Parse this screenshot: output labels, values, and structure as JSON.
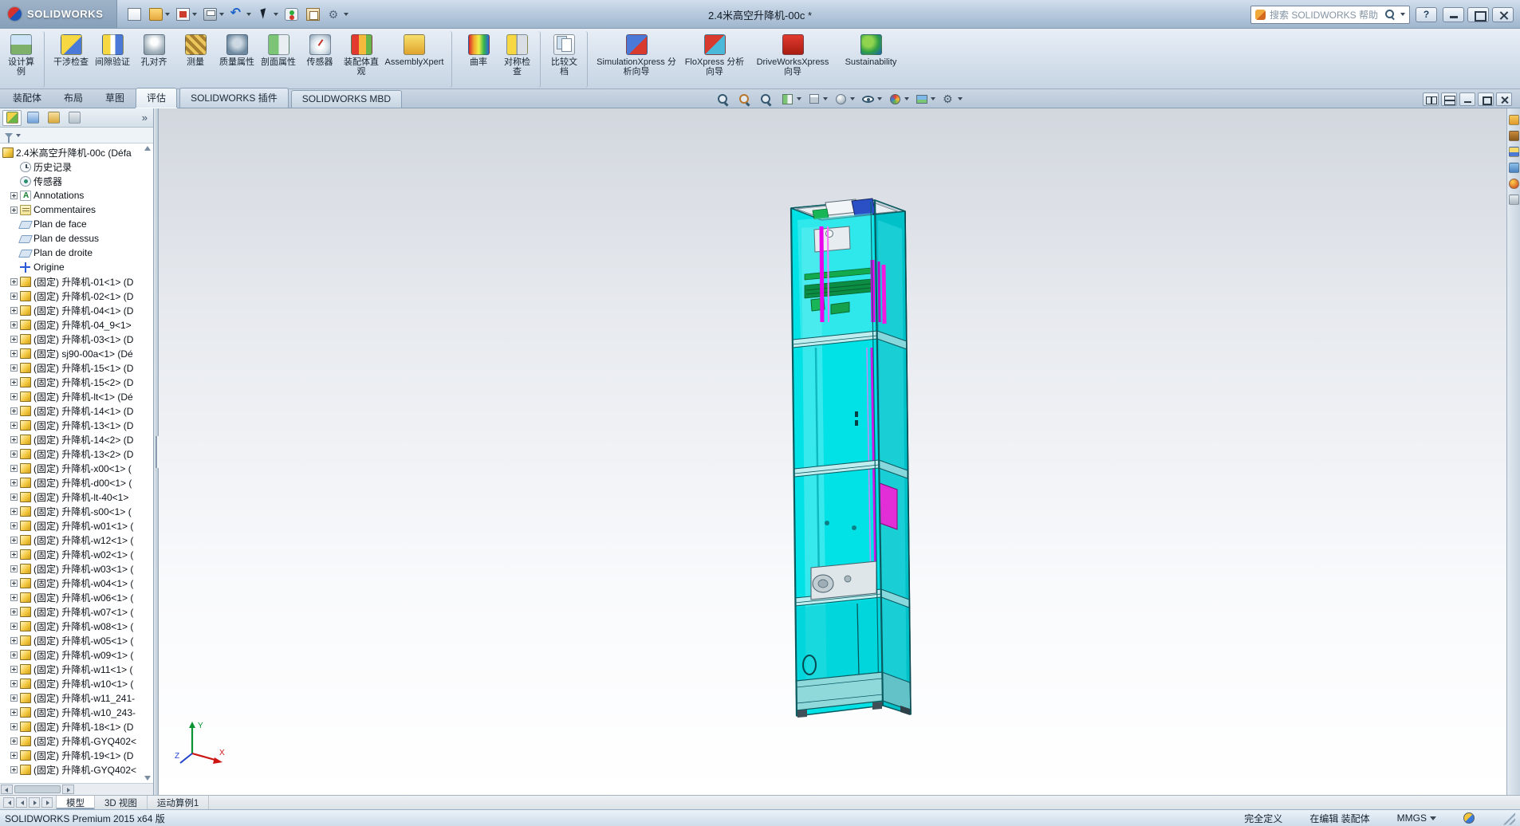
{
  "titlebar": {
    "brand": "SOLIDWORKS",
    "title": "2.4米高空升降机-00c *",
    "search_placeholder": "搜索 SOLIDWORKS 帮助",
    "help_glyph": "?",
    "qat": [
      {
        "icon": "q-new",
        "name": "new-document-icon",
        "dd": "dd-no"
      },
      {
        "icon": "q-open",
        "name": "open-icon",
        "dd": "dd-yes"
      },
      {
        "icon": "q-save",
        "name": "save-icon",
        "dd": "dd-yes"
      },
      {
        "icon": "q-print",
        "name": "print-icon",
        "dd": "dd-yes"
      },
      {
        "icon": "q-undo",
        "name": "undo-icon",
        "dd": "dd-yes"
      },
      {
        "icon": "q-select",
        "name": "select-icon",
        "dd": "dd-yes"
      },
      {
        "icon": "q-rebuild",
        "name": "rebuild-icon",
        "dd": "dd-no"
      },
      {
        "icon": "q-props",
        "name": "file-properties-icon",
        "dd": "dd-no"
      },
      {
        "icon": "q-options",
        "name": "options-icon",
        "dd": "dd-yes"
      }
    ],
    "window_controls": [
      {
        "cls": "wc-min",
        "name": "window-minimize-button"
      },
      {
        "cls": "wc-max",
        "name": "window-maximize-button"
      },
      {
        "cls": "wc-close",
        "name": "window-close-button"
      }
    ]
  },
  "ribbon": {
    "buttons": [
      {
        "label": "设计算例",
        "icon": "i-design-study",
        "name": "design-study-button",
        "cls": "w-s sep-after"
      },
      {
        "label": "干涉检查",
        "icon": "i-interference",
        "name": "interference-check-button",
        "cls": "w-s"
      },
      {
        "label": "间隙验证",
        "icon": "i-clearance",
        "name": "clearance-verification-button",
        "cls": "w-s"
      },
      {
        "label": "孔对齐",
        "icon": "i-hole-align",
        "name": "hole-alignment-button",
        "cls": "w-s"
      },
      {
        "label": "测量",
        "icon": "i-measure",
        "name": "measure-button",
        "cls": "w-s"
      },
      {
        "label": "质量属性",
        "icon": "i-mass",
        "name": "mass-properties-button",
        "cls": "w-s"
      },
      {
        "label": "剖面属性",
        "icon": "i-section-prop",
        "name": "section-properties-button",
        "cls": "w-s"
      },
      {
        "label": "传感器",
        "icon": "i-sensor",
        "name": "sensor-button",
        "cls": "w-s"
      },
      {
        "label": "装配体直观",
        "icon": "i-assembly-vis",
        "name": "assembly-visualization-button",
        "cls": "w-s"
      },
      {
        "label": "AssemblyXpert",
        "icon": "i-assemblyxpert",
        "name": "assemblyxpert-button",
        "cls": "w-m sep-after"
      },
      {
        "label": "曲率",
        "icon": "i-curvature",
        "name": "curvature-button",
        "cls": "w-s"
      },
      {
        "label": "对称检查",
        "icon": "i-symmetry",
        "name": "symmetry-check-button",
        "cls": "w-s sep-after"
      },
      {
        "label": "比较文档",
        "icon": "i-compare",
        "name": "compare-documents-button",
        "cls": "w-s sep-after"
      },
      {
        "label": "SimulationXpress 分析向导",
        "icon": "i-simx",
        "name": "simulationxpress-wizard-button",
        "cls": "w-l"
      },
      {
        "label": "FloXpress 分析向导",
        "icon": "i-flox",
        "name": "floxpress-wizard-button",
        "cls": "w-m"
      },
      {
        "label": "DriveWorksXpress 向导",
        "icon": "i-dwx",
        "name": "driveworksxpress-wizard-button",
        "cls": "w-l"
      },
      {
        "label": "Sustainability",
        "icon": "i-sust",
        "name": "sustainability-button",
        "cls": "w-m"
      }
    ]
  },
  "command_tabs": [
    {
      "label": "装配体",
      "cls": "",
      "name": "tab-assembly"
    },
    {
      "label": "布局",
      "cls": "",
      "name": "tab-layout"
    },
    {
      "label": "草图",
      "cls": "",
      "name": "tab-sketch"
    },
    {
      "label": "评估",
      "cls": "active",
      "name": "tab-evaluate"
    },
    {
      "label": "SOLIDWORKS 插件",
      "cls": "boxed",
      "name": "tab-solidworks-addins"
    },
    {
      "label": "SOLIDWORKS MBD",
      "cls": "boxed",
      "name": "tab-solidworks-mbd"
    }
  ],
  "viewport_toolbar": [
    {
      "icon": "mag",
      "name": "zoom-to-fit-icon",
      "dd": "dd-no"
    },
    {
      "icon": "mag vt-zoomarea",
      "name": "zoom-to-area-icon",
      "dd": "dd-no"
    },
    {
      "icon": "mag",
      "name": "previous-view-icon",
      "dd": "dd-no"
    },
    {
      "icon": "vt-section",
      "name": "section-view-icon",
      "dd": "dd-yes"
    },
    {
      "icon": "vt-cube",
      "name": "view-orientation-icon",
      "dd": "dd-yes"
    },
    {
      "icon": "vt-sphere",
      "name": "display-style-icon",
      "dd": "dd-yes"
    },
    {
      "icon": "vt-eye",
      "name": "hide-show-items-icon",
      "dd": "dd-yes"
    },
    {
      "icon": "vt-ball",
      "name": "edit-appearance-icon",
      "dd": "dd-yes"
    },
    {
      "icon": "vt-scene",
      "name": "apply-scene-icon",
      "dd": "dd-yes"
    },
    {
      "icon": "vt-gear",
      "name": "view-settings-icon",
      "dd": "dd-yes"
    }
  ],
  "doc_window_controls": [
    {
      "icon": "dw-grid",
      "name": "tile-windows-icon"
    },
    {
      "icon": "dw-grid2",
      "name": "cascade-windows-icon"
    },
    {
      "icon": "dw-min",
      "name": "minimize-document-icon"
    },
    {
      "icon": "dw-restore",
      "name": "restore-document-icon"
    },
    {
      "icon": "dw-close",
      "name": "close-document-icon"
    }
  ],
  "panel": {
    "more_glyph": "»",
    "tabs": [
      {
        "icon": "pt-feature",
        "cls": "active",
        "name": "featuremanager-tab"
      },
      {
        "icon": "pt-property",
        "cls": "",
        "name": "propertymanager-tab"
      },
      {
        "icon": "pt-config",
        "cls": "",
        "name": "configurationmanager-tab"
      },
      {
        "icon": "pt-dimx",
        "cls": "",
        "name": "dimxpertmanager-tab"
      }
    ],
    "tree": {
      "root": {
        "label": "2.4米高空升降机-00c (Défa"
      },
      "items": [
        {
          "label": "历史记录",
          "icon": "ic-history",
          "exp": "exp-none"
        },
        {
          "label": "传感器",
          "icon": "ic-sensors",
          "exp": "exp-none"
        },
        {
          "label": "Annotations",
          "icon": "ic-annotations",
          "exp": "exp-plus"
        },
        {
          "label": "Commentaires",
          "icon": "ic-comments",
          "exp": "exp-plus"
        },
        {
          "label": "Plan de face",
          "icon": "ic-plane",
          "exp": "exp-none"
        },
        {
          "label": "Plan de dessus",
          "icon": "ic-plane",
          "exp": "exp-none"
        },
        {
          "label": "Plan de droite",
          "icon": "ic-plane",
          "exp": "exp-none"
        },
        {
          "label": "Origine",
          "icon": "ic-origin",
          "exp": "exp-none"
        },
        {
          "label": "(固定) 升降机-01<1> (D",
          "icon": "ic-assembly",
          "exp": "exp-plus"
        },
        {
          "label": "(固定) 升降机-02<1> (D",
          "icon": "ic-assembly",
          "exp": "exp-plus"
        },
        {
          "label": "(固定) 升降机-04<1> (D",
          "icon": "ic-assembly",
          "exp": "exp-plus"
        },
        {
          "label": "(固定) 升降机-04_9<1>",
          "icon": "ic-assembly",
          "exp": "exp-plus"
        },
        {
          "label": "(固定) 升降机-03<1> (D",
          "icon": "ic-assembly",
          "exp": "exp-plus"
        },
        {
          "label": "(固定) sj90-00a<1> (Dé",
          "icon": "ic-assembly",
          "exp": "exp-plus"
        },
        {
          "label": "(固定) 升降机-15<1> (D",
          "icon": "ic-assembly",
          "exp": "exp-plus"
        },
        {
          "label": "(固定) 升降机-15<2> (D",
          "icon": "ic-assembly",
          "exp": "exp-plus"
        },
        {
          "label": "(固定) 升降机-lt<1> (Dé",
          "icon": "ic-assembly",
          "exp": "exp-plus"
        },
        {
          "label": "(固定) 升降机-14<1> (D",
          "icon": "ic-assembly",
          "exp": "exp-plus"
        },
        {
          "label": "(固定) 升降机-13<1> (D",
          "icon": "ic-assembly",
          "exp": "exp-plus"
        },
        {
          "label": "(固定) 升降机-14<2> (D",
          "icon": "ic-assembly",
          "exp": "exp-plus"
        },
        {
          "label": "(固定) 升降机-13<2> (D",
          "icon": "ic-assembly",
          "exp": "exp-plus"
        },
        {
          "label": "(固定) 升降机-x00<1> (",
          "icon": "ic-assembly",
          "exp": "exp-plus"
        },
        {
          "label": "(固定) 升降机-d00<1> (",
          "icon": "ic-assembly",
          "exp": "exp-plus"
        },
        {
          "label": "(固定) 升降机-lt-40<1>",
          "icon": "ic-assembly",
          "exp": "exp-plus"
        },
        {
          "label": "(固定) 升降机-s00<1> (",
          "icon": "ic-assembly",
          "exp": "exp-plus"
        },
        {
          "label": "(固定) 升降机-w01<1> (",
          "icon": "ic-assembly",
          "exp": "exp-plus"
        },
        {
          "label": "(固定) 升降机-w12<1> (",
          "icon": "ic-assembly",
          "exp": "exp-plus"
        },
        {
          "label": "(固定) 升降机-w02<1> (",
          "icon": "ic-assembly",
          "exp": "exp-plus"
        },
        {
          "label": "(固定) 升降机-w03<1> (",
          "icon": "ic-assembly",
          "exp": "exp-plus"
        },
        {
          "label": "(固定) 升降机-w04<1> (",
          "icon": "ic-assembly",
          "exp": "exp-plus"
        },
        {
          "label": "(固定) 升降机-w06<1> (",
          "icon": "ic-assembly",
          "exp": "exp-plus"
        },
        {
          "label": "(固定) 升降机-w07<1> (",
          "icon": "ic-assembly",
          "exp": "exp-plus"
        },
        {
          "label": "(固定) 升降机-w08<1> (",
          "icon": "ic-assembly",
          "exp": "exp-plus"
        },
        {
          "label": "(固定) 升降机-w05<1> (",
          "icon": "ic-assembly",
          "exp": "exp-plus"
        },
        {
          "label": "(固定) 升降机-w09<1> (",
          "icon": "ic-assembly",
          "exp": "exp-plus"
        },
        {
          "label": "(固定) 升降机-w11<1> (",
          "icon": "ic-assembly",
          "exp": "exp-plus"
        },
        {
          "label": "(固定) 升降机-w10<1> (",
          "icon": "ic-assembly",
          "exp": "exp-plus"
        },
        {
          "label": "(固定) 升降机-w11_241-",
          "icon": "ic-assembly",
          "exp": "exp-plus"
        },
        {
          "label": "(固定) 升降机-w10_243-",
          "icon": "ic-assembly",
          "exp": "exp-plus"
        },
        {
          "label": "(固定) 升降机-18<1> (D",
          "icon": "ic-assembly",
          "exp": "exp-plus"
        },
        {
          "label": "(固定) 升降机-GYQ402<",
          "icon": "ic-assembly",
          "exp": "exp-plus"
        },
        {
          "label": "(固定) 升降机-19<1> (D",
          "icon": "ic-assembly",
          "exp": "exp-plus"
        },
        {
          "label": "(固定) 升降机-GYQ402<",
          "icon": "ic-assembly",
          "exp": "exp-plus"
        }
      ]
    }
  },
  "taskpane": [
    {
      "icon": "tp-home",
      "name": "solidworks-resources-icon"
    },
    {
      "icon": "tp-library",
      "name": "design-library-icon"
    },
    {
      "icon": "tp-explorer",
      "name": "file-explorer-icon"
    },
    {
      "icon": "tp-palette",
      "name": "view-palette-icon"
    },
    {
      "icon": "tp-appearance",
      "name": "appearances-scenes-icon"
    },
    {
      "icon": "tp-props",
      "name": "custom-properties-icon"
    }
  ],
  "viewport": {
    "triad": {
      "x": "X",
      "y": "Y",
      "z": "Z"
    }
  },
  "doc_tabs": [
    {
      "label": "模型",
      "cls": "active",
      "name": "doc-tab-model"
    },
    {
      "label": "3D 视图",
      "cls": "",
      "name": "doc-tab-3d-views"
    },
    {
      "label": "运动算例1",
      "cls": "",
      "name": "doc-tab-motion-study-1"
    }
  ],
  "statusbar": {
    "left": "SOLIDWORKS Premium 2015 x64 版",
    "defined": "完全定义",
    "editing": "在编辑 装配体",
    "units": "MMGS"
  }
}
